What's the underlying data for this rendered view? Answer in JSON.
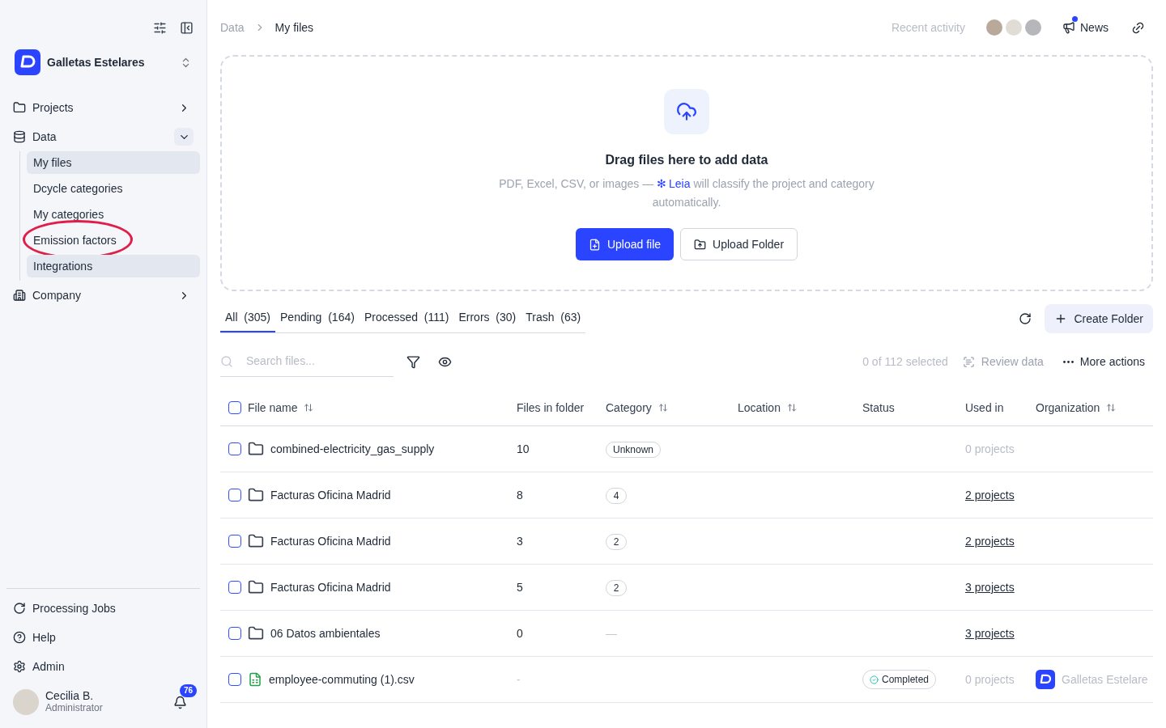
{
  "sidebar": {
    "org_name": "Galletas Estelares",
    "nav": [
      {
        "label": "Projects",
        "kind": "folder",
        "expanded": false
      },
      {
        "label": "Data",
        "kind": "data",
        "expanded": true,
        "children": [
          {
            "label": "My files",
            "highlighted": true
          },
          {
            "label": "Dcycle categories",
            "highlighted": false
          },
          {
            "label": "My categories",
            "highlighted": false
          },
          {
            "label": "Emission factors",
            "highlighted": false,
            "circled": true
          },
          {
            "label": "Integrations",
            "highlighted": true
          }
        ]
      },
      {
        "label": "Company",
        "kind": "company",
        "expanded": false
      }
    ],
    "footer": [
      {
        "label": "Processing Jobs",
        "kind": "jobs"
      },
      {
        "label": "Help",
        "kind": "help"
      },
      {
        "label": "Admin",
        "kind": "admin"
      }
    ],
    "user": {
      "name": "Cecilia B.",
      "role": "Administrator",
      "notifications": "76"
    }
  },
  "breadcrumb": [
    "Data",
    "My files"
  ],
  "topbar": {
    "recent_activity": "Recent activity",
    "news": "News"
  },
  "dropzone": {
    "title": "Drag files here to add data",
    "hint_before": "PDF, Excel, CSV, or images —",
    "assistant_icon": "✻",
    "assistant": "Leia",
    "hint_after": "will classify the project and category automatically.",
    "buttons": [
      {
        "label": "Upload file",
        "kind": "primary"
      },
      {
        "label": "Upload Folder",
        "kind": "secondary"
      }
    ]
  },
  "tabs": [
    {
      "label": "All",
      "count": "(305)",
      "selected": true
    },
    {
      "label": "Pending",
      "count": "(164)",
      "selected": false
    },
    {
      "label": "Processed",
      "count": "(111)",
      "selected": false
    },
    {
      "label": "Errors",
      "count": "(30)",
      "selected": false
    },
    {
      "label": "Trash",
      "count": "(63)",
      "selected": false
    }
  ],
  "create_folder": "Create Folder",
  "toolbar": {
    "search_placeholder": "Search files...",
    "selection": "0 of 112 selected",
    "review": "Review data",
    "more": "More actions"
  },
  "table": {
    "select_all_checked": false,
    "columns": [
      {
        "label": "File name",
        "sortable": true
      },
      {
        "label": "Files in folder",
        "sortable": false
      },
      {
        "label": "Category",
        "sortable": true
      },
      {
        "label": "Location",
        "sortable": true
      },
      {
        "label": "Status",
        "sortable": false
      },
      {
        "label": "Used in",
        "sortable": false
      },
      {
        "label": "Organization",
        "sortable": true
      }
    ],
    "rows": [
      {
        "kind": "folder",
        "checked": false,
        "name": "combined-electricity_gas_supply",
        "files": "10",
        "category": {
          "kind": "badge",
          "text": "Unknown"
        },
        "used_in": {
          "text": "0 projects",
          "linked": false
        }
      },
      {
        "kind": "folder",
        "checked": false,
        "name": "Facturas Oficina Madrid",
        "files": "8",
        "category": {
          "kind": "badge",
          "text": "4"
        },
        "used_in": {
          "text": "2 projects",
          "linked": true
        }
      },
      {
        "kind": "folder",
        "checked": false,
        "name": "Facturas Oficina Madrid",
        "files": "3",
        "category": {
          "kind": "badge",
          "text": "2"
        },
        "used_in": {
          "text": "2 projects",
          "linked": true
        }
      },
      {
        "kind": "folder",
        "checked": false,
        "name": "Facturas Oficina Madrid",
        "files": "5",
        "category": {
          "kind": "badge",
          "text": "2"
        },
        "used_in": {
          "text": "3 projects",
          "linked": true
        }
      },
      {
        "kind": "folder",
        "checked": false,
        "name": "06 Datos ambientales",
        "files": "0",
        "category": {
          "kind": "dash",
          "text": "—"
        },
        "used_in": {
          "text": "3 projects",
          "linked": true
        }
      },
      {
        "kind": "file",
        "checked": false,
        "name": "employee-commuting (1).csv",
        "files": "-",
        "status": "Completed",
        "used_in": {
          "text": "0 projects",
          "linked": false
        },
        "organization": "Galletas Estelare"
      }
    ]
  }
}
